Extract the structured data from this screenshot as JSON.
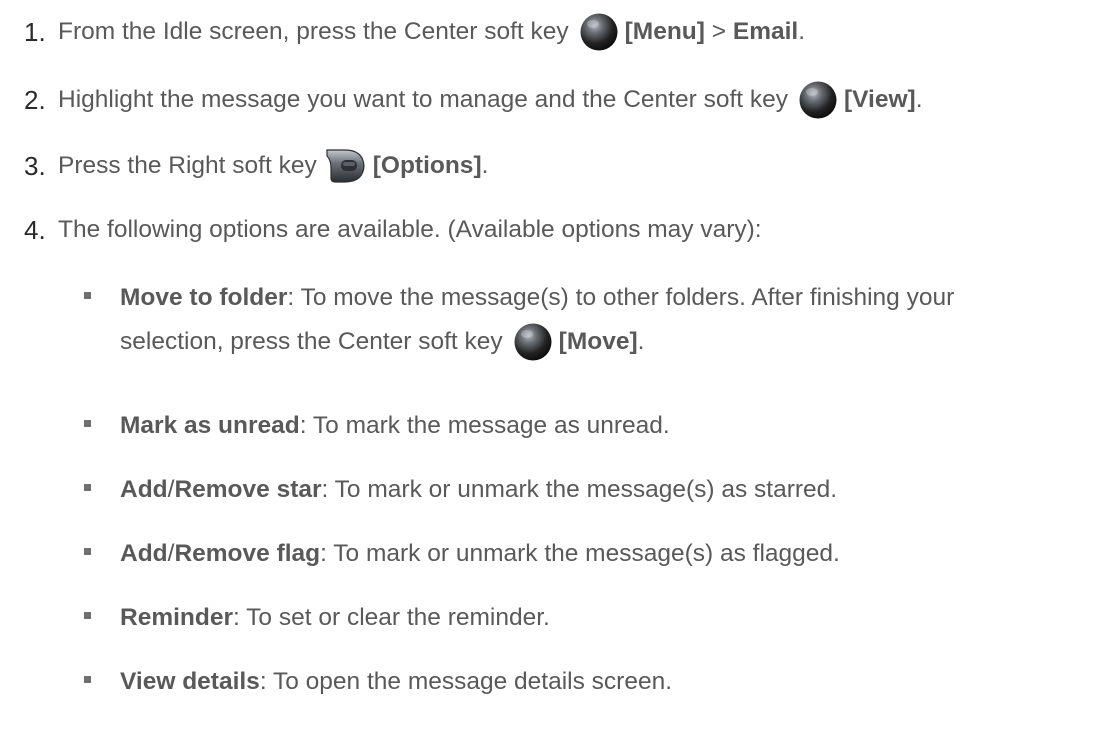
{
  "steps": [
    {
      "number": "1.",
      "parts": [
        "From the Idle screen, press the Center soft key",
        "[Menu]",
        " > ",
        "Email",
        "."
      ],
      "icon": "center-soft-key-icon"
    },
    {
      "number": "2.",
      "parts": [
        "Highlight the message you want to manage and the Center soft key",
        "[View]",
        "."
      ],
      "icon": "center-soft-key-icon"
    },
    {
      "number": "3.",
      "parts": [
        "Press the Right soft key",
        "[Options]",
        "."
      ],
      "icon": "right-soft-key-icon"
    },
    {
      "number": "4.",
      "text": "The following options are available. (Available options may vary):"
    }
  ],
  "options": [
    {
      "title": "Move to folder",
      "desc_line1": ": To move the message(s) to other folders. After finishing your",
      "desc_line2": "selection, press the Center soft key",
      "key_label": "[Move]",
      "end": "."
    },
    {
      "title": "Mark as unread",
      "desc": ": To mark the message as unread."
    },
    {
      "title_a": "Add",
      "slash": "/",
      "title_b": "Remove star",
      "desc": ": To mark or unmark the message(s) as starred."
    },
    {
      "title_a": "Add",
      "slash": "/",
      "title_b": "Remove flag",
      "desc": ": To mark or unmark the message(s) as flagged."
    },
    {
      "title": "Reminder",
      "desc": ": To set or clear the reminder."
    },
    {
      "title": "View details",
      "desc": ": To open the message details screen."
    }
  ],
  "colors": {
    "text": "#595959",
    "number": "#2a2a2a",
    "bullet": "#6f6f6f",
    "key_dark": "#1c1c1c",
    "key_highlight": "#8a8f95"
  }
}
